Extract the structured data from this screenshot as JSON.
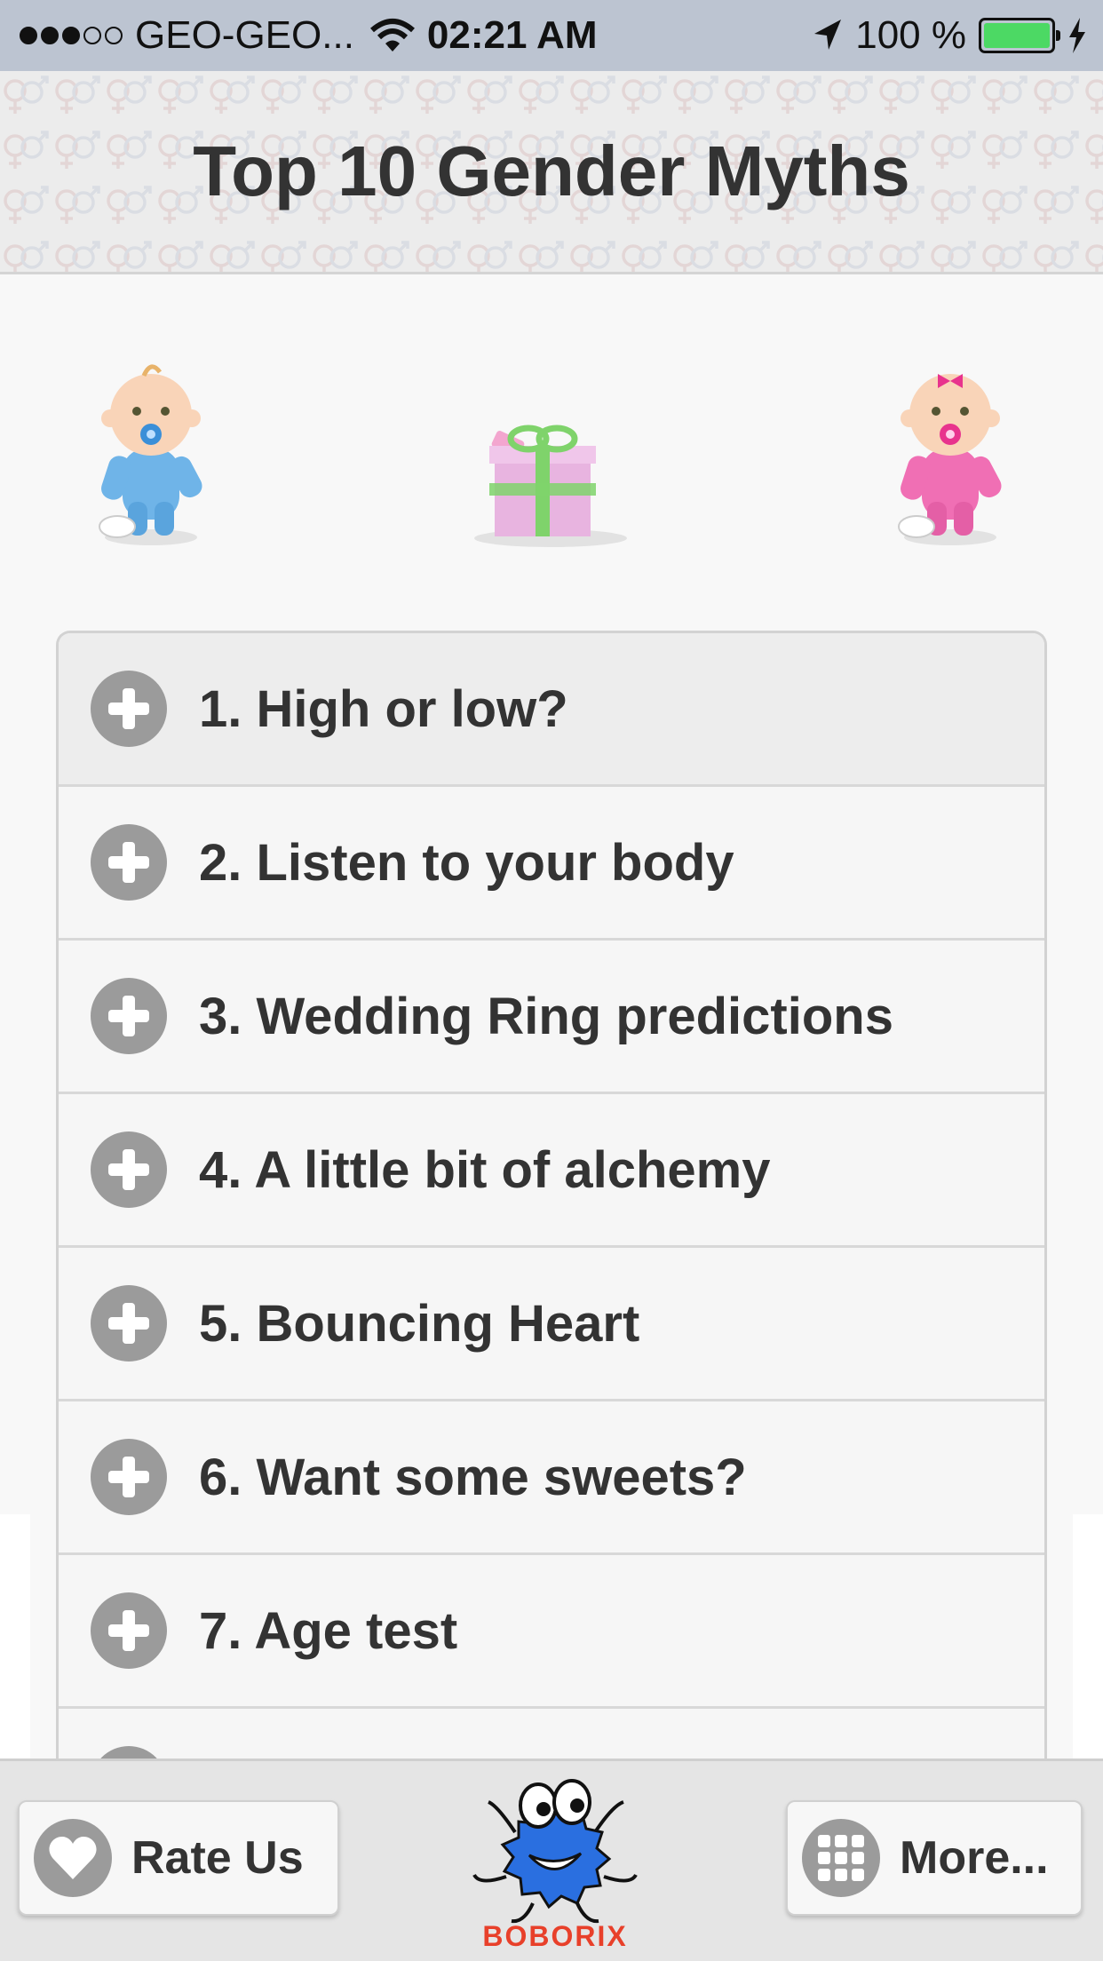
{
  "status_bar": {
    "carrier": "GEO-GEO...",
    "time": "02:21 AM",
    "battery_text": "100 %",
    "battery_color": "#4cd964",
    "signal_filled": 3,
    "signal_total": 5
  },
  "header": {
    "title": "Top 10 Gender Myths"
  },
  "illustrations": {
    "left": "baby-boy-icon",
    "center": "gift-box-icon",
    "right": "baby-girl-icon"
  },
  "myths": [
    {
      "label": "1. High or low?"
    },
    {
      "label": "2. Listen to your body"
    },
    {
      "label": "3. Wedding Ring predictions"
    },
    {
      "label": "4. A little bit of alchemy"
    },
    {
      "label": "5. Bouncing Heart"
    },
    {
      "label": "6. Want some sweets?"
    },
    {
      "label": "7. Age test"
    },
    {
      "label": ""
    }
  ],
  "footer": {
    "rate_label": "Rate Us",
    "more_label": "More...",
    "logo_text": "BOBORIX"
  }
}
